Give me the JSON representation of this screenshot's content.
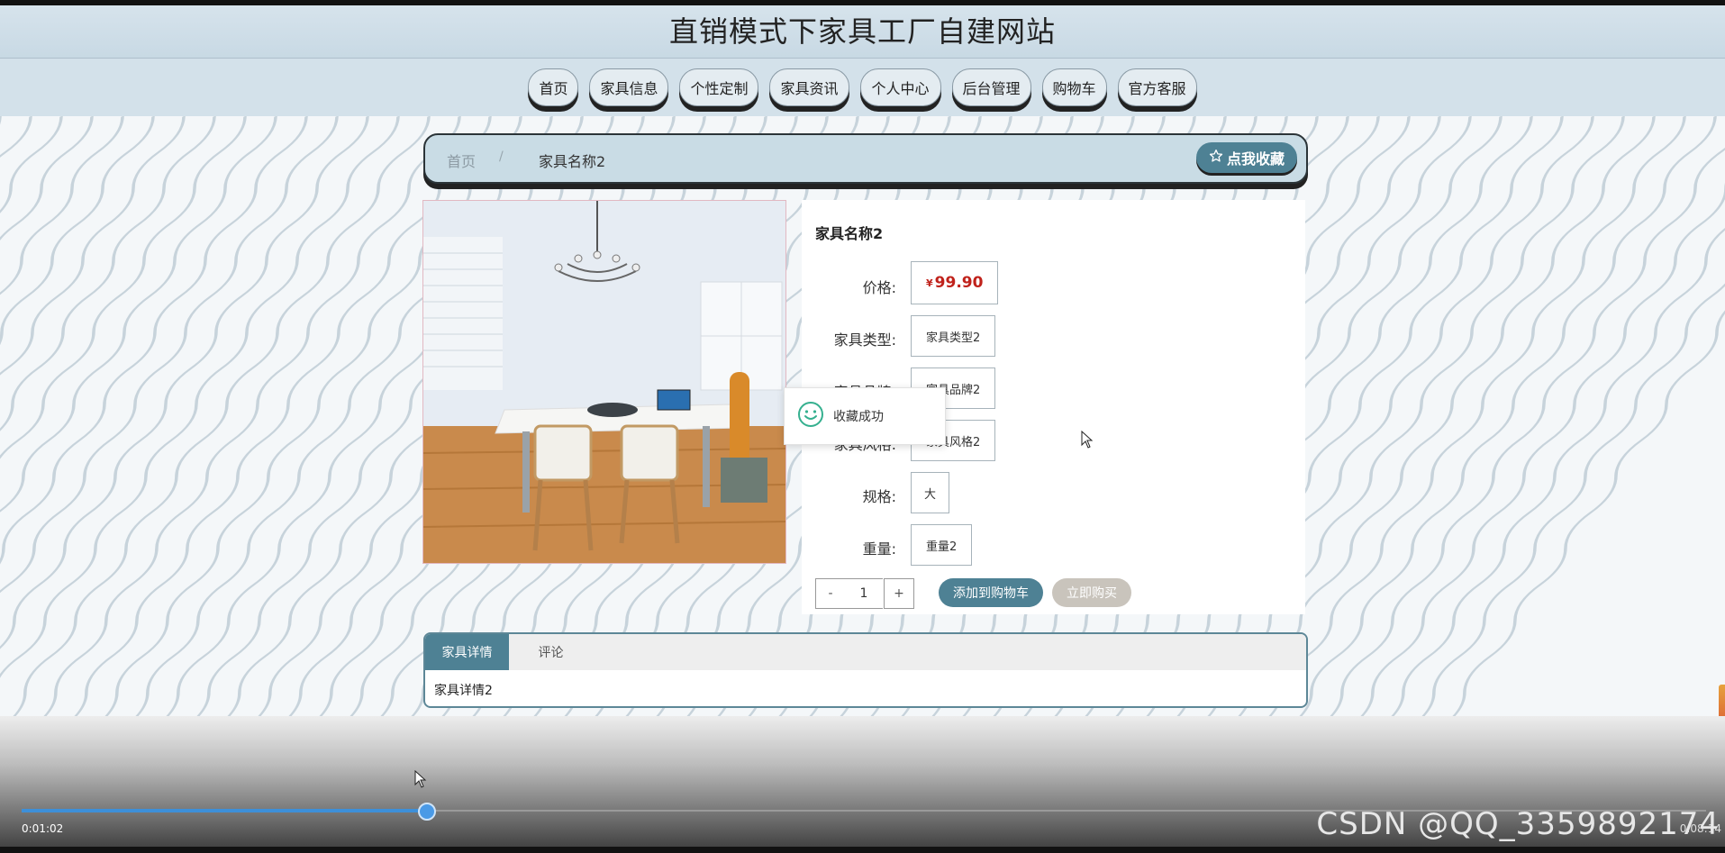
{
  "site": {
    "title": "直销模式下家具工厂自建网站"
  },
  "nav": {
    "items": [
      "首页",
      "家具信息",
      "个性定制",
      "家具资讯",
      "个人中心",
      "后台管理",
      "购物车",
      "官方客服"
    ]
  },
  "breadcrumb": {
    "home": "首页",
    "separator": "/",
    "current": "家具名称2"
  },
  "favorite": {
    "label": "点我收藏",
    "icon": "star-outline-icon"
  },
  "product": {
    "name": "家具名称2",
    "rows": [
      {
        "label": "价格:",
        "currency": "¥",
        "value": "99.90"
      },
      {
        "label": "家具类型:",
        "value": "家具类型2"
      },
      {
        "label": "家具品牌:",
        "value": "家具品牌2"
      },
      {
        "label": "家具风格:",
        "value": "家具风格2"
      },
      {
        "label": "规格:",
        "value": "大"
      },
      {
        "label": "重量:",
        "value": "重量2"
      }
    ]
  },
  "quantity": {
    "minus": "-",
    "value": "1",
    "plus": "+"
  },
  "actions": {
    "add_to_cart": "添加到购物车",
    "buy_now": "立即购买"
  },
  "toast": {
    "text": "收藏成功",
    "icon": "smiley-icon"
  },
  "tabs": {
    "active": "家具详情",
    "other": "评论"
  },
  "detail": {
    "text": "家具详情2"
  },
  "player": {
    "current_time": "0:01:02",
    "total_time": "0:08:14",
    "progress": 0.24,
    "watermark": "CSDN @QQ_3359892174"
  },
  "colors": {
    "accent": "#4e8194",
    "price": "#c0221b",
    "header_bg": "#d3e1ea",
    "progress": "#3d8fd9"
  }
}
